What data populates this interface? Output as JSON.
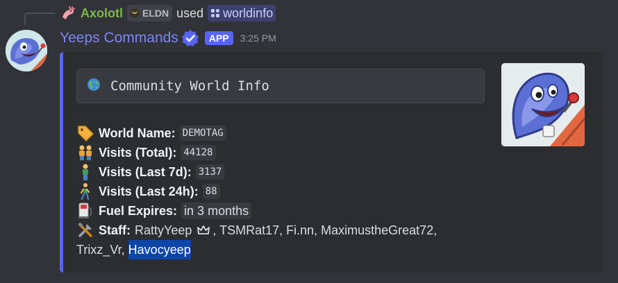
{
  "reply": {
    "user": "Axolotl",
    "guild_tag": "ELDN",
    "used_text": "used",
    "command": "worldinfo"
  },
  "message": {
    "bot_name": "Yeeps Commands",
    "badge": "APP",
    "timestamp": "3:25 PM"
  },
  "embed": {
    "accent_color": "#5865f2",
    "title": "Community World Info",
    "fields": [
      {
        "label": "World Name:",
        "value": "DEMOTAG",
        "icon": "label-tag-icon"
      },
      {
        "label": "Visits (Total):",
        "value": "44128",
        "icon": "people-icon"
      },
      {
        "label": "Visits (Last 7d):",
        "value": "3137",
        "icon": "person-standing-icon"
      },
      {
        "label": "Visits (Last 24h):",
        "value": "88",
        "icon": "person-walking-icon"
      },
      {
        "label": "Fuel Expires:",
        "value": "in 3 months",
        "icon": "fuel-pump-icon"
      }
    ],
    "staff": {
      "label": "Staff:",
      "first": "RattyYeep",
      "rest": ", TSMRat17, Fi.nn, MaximustheGreat72,",
      "line2": "Trixz_Vr,",
      "selected": "Havocyeep"
    }
  }
}
